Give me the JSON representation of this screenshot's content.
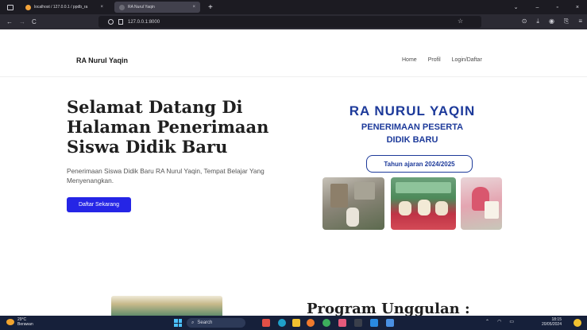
{
  "browser": {
    "tabs": [
      {
        "label": "localhost / 127.0.0.1 / ppdb_ra",
        "close": "×",
        "favicon_color": "#f3a33a"
      },
      {
        "label": "RA Nurul Yaqin",
        "close": "×",
        "favicon_color": "#6b6b75"
      }
    ],
    "new_tab": "+",
    "url": "127.0.0.1:8000",
    "window_controls": [
      "⌄",
      "–",
      "▫",
      "×"
    ],
    "toolbar_icons": [
      "shield-icon",
      "download-icon",
      "account-icon",
      "extensions-icon",
      "menu-icon"
    ],
    "star": "☆"
  },
  "site": {
    "brand": "RA Nurul Yaqin",
    "nav": [
      "Home",
      "Profil",
      "Login/Daftar"
    ],
    "hero": {
      "title": "Selamat Datang Di Halaman Penerimaan Siswa Didik Baru",
      "subtitle": "Penerimaan Siswa Didik Baru RA Nurul Yaqin, Tempat Belajar Yang Menyenangkan.",
      "cta": "Daftar Sekarang"
    },
    "poster": {
      "title": "RA NURUL YAQIN",
      "line2": "PENERIMAAN PESERTA",
      "line3": "DIDIK BARU",
      "badge": "Tahun ajaran 2024/2025"
    },
    "next_section_title": "Program Unggulan :"
  },
  "taskbar": {
    "weather_temp": "29°C",
    "weather_desc": "Berawan",
    "search_placeholder": "Search",
    "time": "18:15",
    "date": "20/05/2024",
    "colors": {
      "accent": "#2525e6",
      "taskbar": "#16203a"
    }
  }
}
